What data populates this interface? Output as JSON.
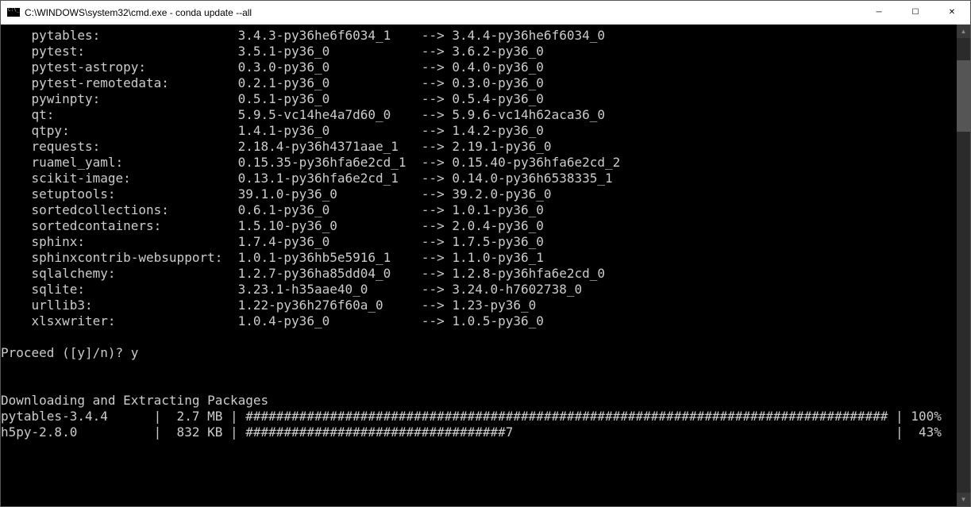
{
  "window": {
    "title": "C:\\WINDOWS\\system32\\cmd.exe - conda  update --all"
  },
  "packages": [
    {
      "name": "pytables:",
      "from": "3.4.3-py36he6f6034_1",
      "to": "3.4.4-py36he6f6034_0"
    },
    {
      "name": "pytest:",
      "from": "3.5.1-py36_0",
      "to": "3.6.2-py36_0"
    },
    {
      "name": "pytest-astropy:",
      "from": "0.3.0-py36_0",
      "to": "0.4.0-py36_0"
    },
    {
      "name": "pytest-remotedata:",
      "from": "0.2.1-py36_0",
      "to": "0.3.0-py36_0"
    },
    {
      "name": "pywinpty:",
      "from": "0.5.1-py36_0",
      "to": "0.5.4-py36_0"
    },
    {
      "name": "qt:",
      "from": "5.9.5-vc14he4a7d60_0",
      "to": "5.9.6-vc14h62aca36_0"
    },
    {
      "name": "qtpy:",
      "from": "1.4.1-py36_0",
      "to": "1.4.2-py36_0"
    },
    {
      "name": "requests:",
      "from": "2.18.4-py36h4371aae_1",
      "to": "2.19.1-py36_0"
    },
    {
      "name": "ruamel_yaml:",
      "from": "0.15.35-py36hfa6e2cd_1",
      "to": "0.15.40-py36hfa6e2cd_2"
    },
    {
      "name": "scikit-image:",
      "from": "0.13.1-py36hfa6e2cd_1",
      "to": "0.14.0-py36h6538335_1"
    },
    {
      "name": "setuptools:",
      "from": "39.1.0-py36_0",
      "to": "39.2.0-py36_0"
    },
    {
      "name": "sortedcollections:",
      "from": "0.6.1-py36_0",
      "to": "1.0.1-py36_0"
    },
    {
      "name": "sortedcontainers:",
      "from": "1.5.10-py36_0",
      "to": "2.0.4-py36_0"
    },
    {
      "name": "sphinx:",
      "from": "1.7.4-py36_0",
      "to": "1.7.5-py36_0"
    },
    {
      "name": "sphinxcontrib-websupport:",
      "from": "1.0.1-py36hb5e5916_1",
      "to": "1.1.0-py36_1"
    },
    {
      "name": "sqlalchemy:",
      "from": "1.2.7-py36ha85dd04_0",
      "to": "1.2.8-py36hfa6e2cd_0"
    },
    {
      "name": "sqlite:",
      "from": "3.23.1-h35aae40_0",
      "to": "3.24.0-h7602738_0"
    },
    {
      "name": "urllib3:",
      "from": "1.22-py36h276f60a_0",
      "to": "1.23-py36_0"
    },
    {
      "name": "xlsxwriter:",
      "from": "1.0.4-py36_0",
      "to": "1.0.5-py36_0"
    }
  ],
  "prompt": {
    "text": "Proceed ([y]/n)? ",
    "input": "y"
  },
  "download_header": "Downloading and Extracting Packages",
  "downloads": [
    {
      "name": "pytables-3.4.4",
      "size": "2.7 MB",
      "bar_full": true,
      "bar_partial": 0,
      "pct": "100%"
    },
    {
      "name": "h5py-2.8.0",
      "size": "832 KB",
      "bar_full": false,
      "bar_partial": 34,
      "pct": "43%"
    }
  ]
}
